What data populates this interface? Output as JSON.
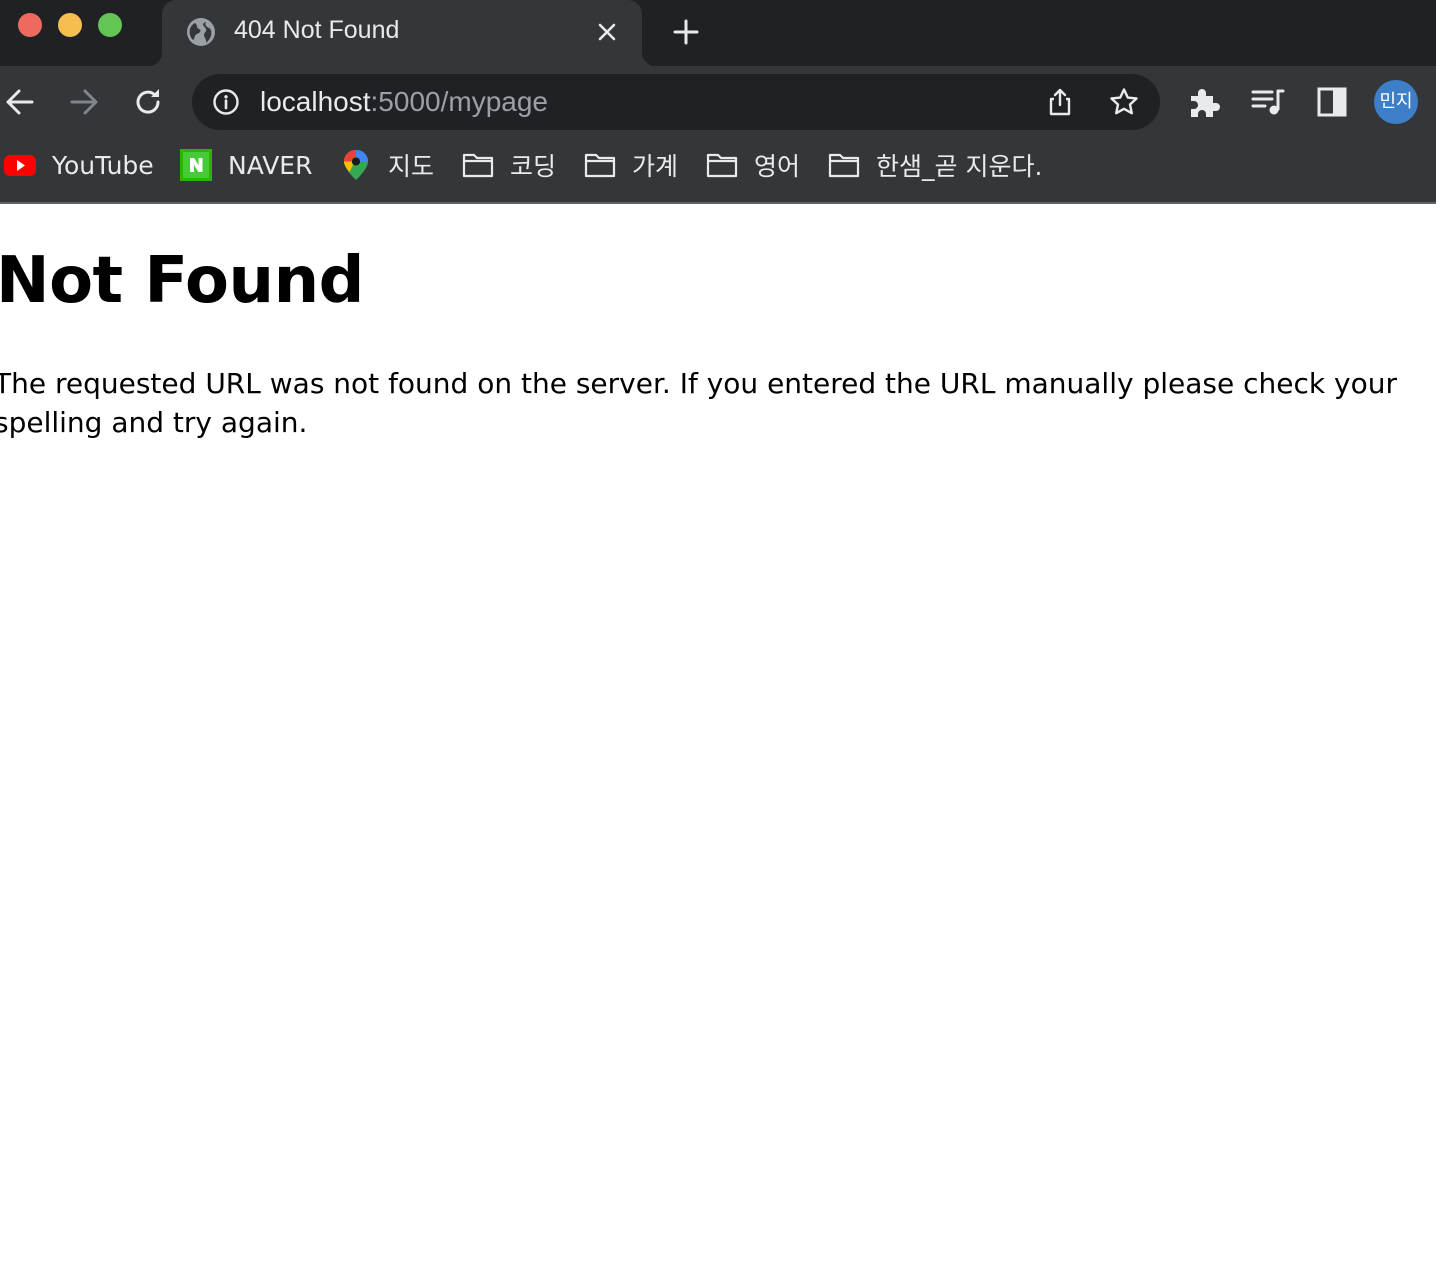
{
  "window": {
    "controls": [
      "close",
      "minimize",
      "maximize"
    ]
  },
  "tab": {
    "title": "404 Not Found",
    "favicon": "globe-icon"
  },
  "toolbar": {
    "back": "arrow-left-icon",
    "forward": "arrow-right-icon",
    "reload": "reload-icon",
    "url_host": "localhost",
    "url_rest": ":5000/mypage",
    "profile_label": "민지"
  },
  "bookmarks": [
    {
      "label": "YouTube",
      "icon": "youtube-icon"
    },
    {
      "label": "NAVER",
      "icon": "naver-icon"
    },
    {
      "label": "지도",
      "icon": "maps-pin-icon"
    },
    {
      "label": "코딩",
      "icon": "folder-icon"
    },
    {
      "label": "가계",
      "icon": "folder-icon"
    },
    {
      "label": "영어",
      "icon": "folder-icon"
    },
    {
      "label": "한샘_곧 지운다.",
      "icon": "folder-icon"
    }
  ],
  "page": {
    "heading": "Not Found",
    "message": "The requested URL was not found on the server. If you entered the URL manually please check your spelling and try again."
  },
  "colors": {
    "tab_strip": "#202124",
    "toolbar": "#35363a",
    "avatar": "#3c7ec7"
  }
}
